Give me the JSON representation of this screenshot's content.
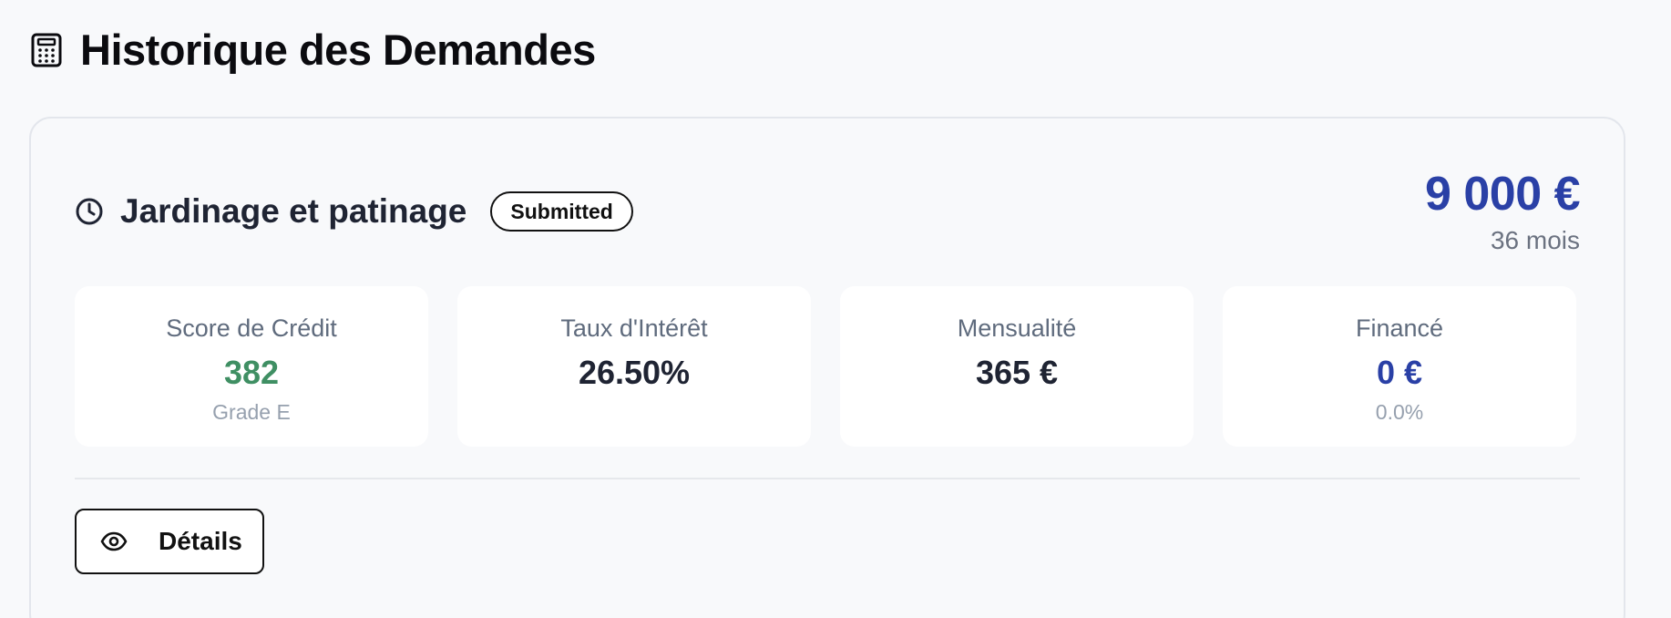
{
  "page": {
    "title": "Historique des Demandes",
    "title_icon": "calculator-icon"
  },
  "request": {
    "title": "Jardinage et patinage",
    "status_icon": "clock-icon",
    "status": "Submitted",
    "amount": "9 000 €",
    "duration": "36 mois",
    "metrics": [
      {
        "label": "Score de Crédit",
        "value": "382",
        "sub": "Grade E",
        "color": "#3f8f63"
      },
      {
        "label": "Taux d'Intérêt",
        "value": "26.50%",
        "sub": "",
        "color": "#1f2433"
      },
      {
        "label": "Mensualité",
        "value": "365 €",
        "sub": "",
        "color": "#1f2433"
      },
      {
        "label": "Financé",
        "value": "0 €",
        "sub": "0.0%",
        "color": "#2a40a6"
      }
    ],
    "details_button": {
      "label": "Détails",
      "icon": "eye-icon"
    }
  },
  "colors": {
    "accent_blue": "#2a40a6",
    "score_green": "#3f8f63",
    "text_dark": "#1f2433",
    "muted": "#6b7280"
  }
}
